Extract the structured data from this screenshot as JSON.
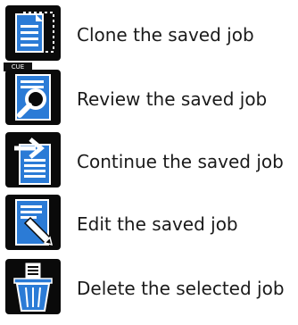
{
  "items": [
    {
      "icon": "clone-icon",
      "label": "Clone the saved job"
    },
    {
      "icon": "review-icon",
      "label": "Review the saved job"
    },
    {
      "icon": "continue-icon",
      "label": "Continue the saved job"
    },
    {
      "icon": "edit-icon",
      "label": "Edit the saved job"
    },
    {
      "icon": "delete-icon",
      "label": "Delete the selected job"
    }
  ],
  "colors": {
    "icon_bg": "#0a0a0a",
    "icon_accent": "#2b7bd6",
    "icon_white": "#ffffff",
    "text": "#1a1a1a"
  },
  "tooltip_text": "CUE"
}
